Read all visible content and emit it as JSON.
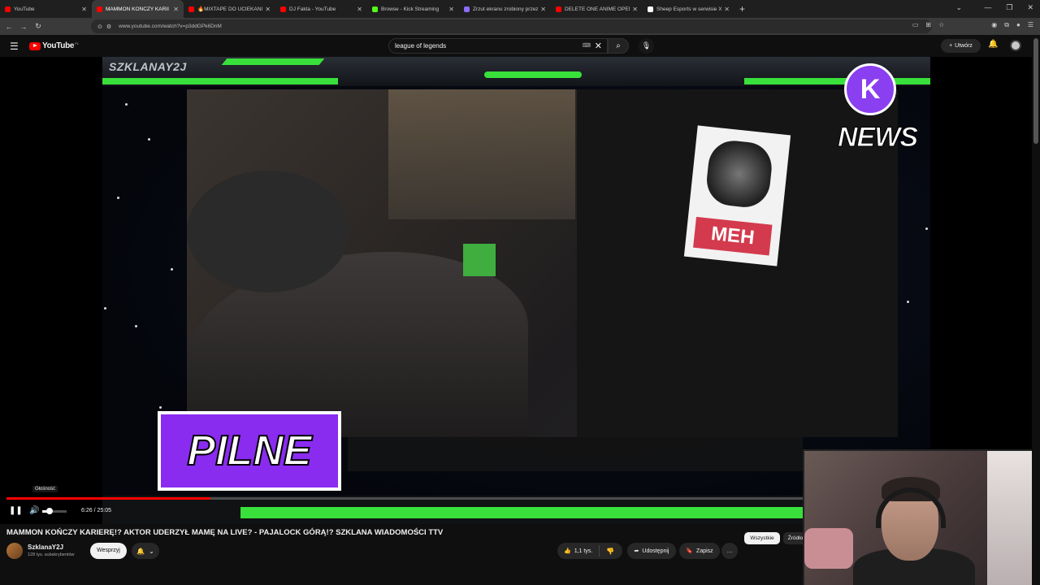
{
  "browser": {
    "tabs": [
      {
        "title": "YouTube",
        "favicon_color": "#ff0000",
        "active": false
      },
      {
        "title": "MAMMON KOŃCZY KARII",
        "favicon_color": "#ff0000",
        "active": true
      },
      {
        "title": "🔥MIXTAPE DO UCIEKANIA",
        "favicon_color": "#ff0000",
        "active": false
      },
      {
        "title": "DJ Fakta - YouTube",
        "favicon_color": "#ff0000",
        "active": false
      },
      {
        "title": "Browse - Kick Streaming",
        "favicon_color": "#53fc18",
        "active": false
      },
      {
        "title": "Zrzut ekranu zrobiony przez Lig",
        "favicon_color": "#8a6cff",
        "active": false
      },
      {
        "title": "DELETE ONE ANIME OPENING",
        "favicon_color": "#ff0000",
        "active": false
      },
      {
        "title": "Sheep Esports w serwisie X: „Sl",
        "favicon_color": "#ffffff",
        "active": false
      }
    ],
    "url": "www.youtube.com/watch?v=p3ddGPk6DnM"
  },
  "youtube": {
    "logo_text": "YouTube",
    "logo_country": "PL",
    "search_value": "league of legends",
    "create_label": "Utwórz"
  },
  "player": {
    "overlay_channel_tag": "SZKLANAY2J",
    "overlay_logo_letter": "K",
    "overlay_logo_text": "NEWS",
    "overlay_banner": "PILNE",
    "shirt_text": "MEH",
    "current_time": "6:26",
    "duration": "25:05",
    "time_display": "6:26 / 25:05",
    "progress_fraction": 0.2565,
    "volume_fraction": 0.3,
    "volume_tooltip": "Głośność"
  },
  "video": {
    "title": "MAMMON KOŃCZY KARIERĘ!? AKTOR UDERZYŁ MAMĘ NA LIVE? - PAJALOCK GÓRĄ!? SZKLANA WIADOMOŚCI TTV",
    "channel_name": "SzklanaY2J",
    "subscribers": "128 tys. subskrybentów",
    "support_label": "Wesprzyj",
    "likes": "1,1 tys.",
    "share_label": "Udostępnij",
    "save_label": "Zapisz",
    "more_label": "…"
  },
  "chips": {
    "all_label": "Wszystkie",
    "source_label": "Źródło"
  },
  "colors": {
    "youtube_red": "#ff0000",
    "overlay_green": "#39e03b",
    "overlay_purple": "#8a2bf0",
    "background": "#0f0f0f"
  }
}
